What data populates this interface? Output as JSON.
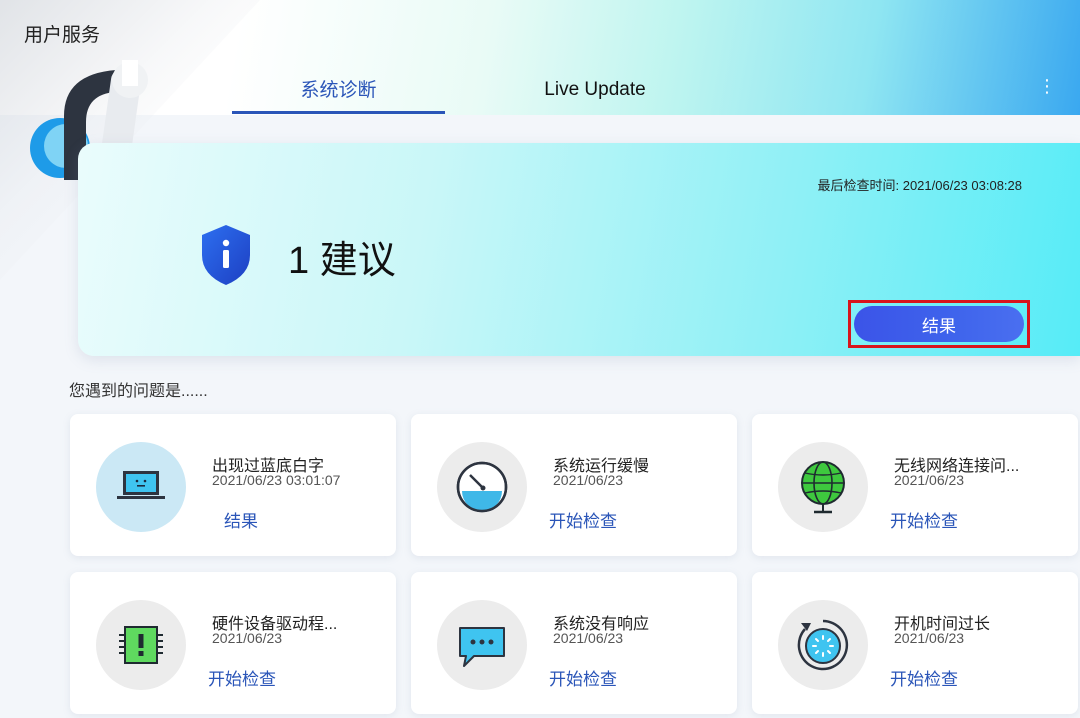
{
  "app": {
    "title": "用户服务"
  },
  "tabs": [
    {
      "label": "系统诊断",
      "active": true
    },
    {
      "label": "Live Update",
      "active": false
    }
  ],
  "menu": {
    "kebab_icon": "more-vertical-icon"
  },
  "banner": {
    "last_check_label": "最后检查时间:",
    "last_check_time": "2021/06/23 03:08:28",
    "suggestion_text": "1 建议",
    "result_button": "结果",
    "icon": "info-shield-icon"
  },
  "problems": {
    "label": "您遇到的问题是......",
    "cards": [
      {
        "title": "出现过蓝底白字",
        "date": "2021/06/23 03:01:07",
        "action": "结果",
        "icon": "laptop-bluescreen-icon"
      },
      {
        "title": "系统运行缓慢",
        "date": "2021/06/23",
        "action": "开始检查",
        "icon": "speedometer-icon"
      },
      {
        "title": "无线网络连接问...",
        "date": "2021/06/23",
        "action": "开始检查",
        "icon": "globe-network-icon"
      },
      {
        "title": "硬件设备驱动程...",
        "date": "2021/06/23",
        "action": "开始检查",
        "icon": "chip-warning-icon"
      },
      {
        "title": "系统没有响应",
        "date": "2021/06/23",
        "action": "开始检查",
        "icon": "chat-bubble-icon"
      },
      {
        "title": "开机时间过长",
        "date": "2021/06/23",
        "action": "开始检查",
        "icon": "boot-timer-icon"
      }
    ]
  },
  "colors": {
    "accent": "#2a55b8",
    "button": "#3b54e8",
    "highlight_frame": "#d8141c"
  }
}
